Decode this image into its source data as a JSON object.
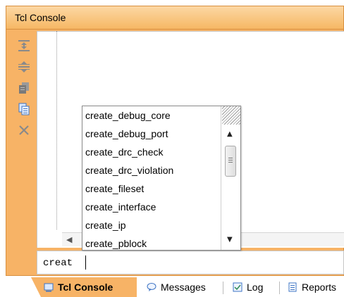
{
  "window": {
    "title": "Tcl Console"
  },
  "toolbar": {
    "icons": [
      "collapse-all-icon",
      "expand-all-icon",
      "page-icon",
      "copy-icon",
      "clear-icon"
    ]
  },
  "console": {
    "input_value": "creat"
  },
  "autocomplete": {
    "items": [
      "create_debug_core",
      "create_debug_port",
      "create_drc_check",
      "create_drc_violation",
      "create_fileset",
      "create_interface",
      "create_ip",
      "create_pblock"
    ]
  },
  "tabs": [
    {
      "label": "Tcl Console",
      "icon": "console-icon",
      "active": true
    },
    {
      "label": "Messages",
      "icon": "speech-bubble-icon",
      "active": false
    },
    {
      "label": "Log",
      "icon": "log-icon",
      "active": false
    },
    {
      "label": "Reports",
      "icon": "report-icon",
      "active": false
    }
  ],
  "colors": {
    "accent": "#f7b366",
    "border": "#d89040"
  }
}
